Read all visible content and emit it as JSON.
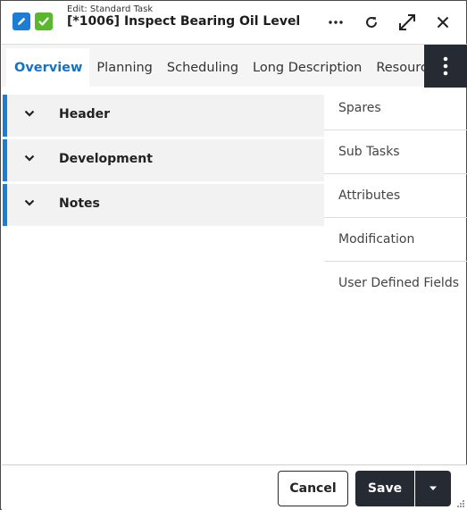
{
  "header": {
    "subtitle": "Edit: Standard Task",
    "title": "[*1006] Inspect Bearing Oil Level",
    "icons": [
      "pencil-icon",
      "check-icon",
      "more-horizontal-icon",
      "refresh-icon",
      "expand-icon",
      "close-icon"
    ]
  },
  "tabs": [
    {
      "label": "Overview",
      "active": true
    },
    {
      "label": "Planning"
    },
    {
      "label": "Scheduling"
    },
    {
      "label": "Long Description"
    },
    {
      "label": "Resources"
    }
  ],
  "sections": [
    {
      "label": "Header"
    },
    {
      "label": "Development"
    },
    {
      "label": "Notes"
    }
  ],
  "side_menu": [
    {
      "label": "Spares"
    },
    {
      "label": "Sub Tasks"
    },
    {
      "label": "Attributes"
    },
    {
      "label": "Modification"
    },
    {
      "label": "User Defined Fields"
    }
  ],
  "footer": {
    "cancel_label": "Cancel",
    "save_label": "Save"
  },
  "colors": {
    "accent": "#1b7ed6",
    "active_tab": "#1572c4",
    "dark": "#262a33",
    "check": "#5bb82e"
  }
}
